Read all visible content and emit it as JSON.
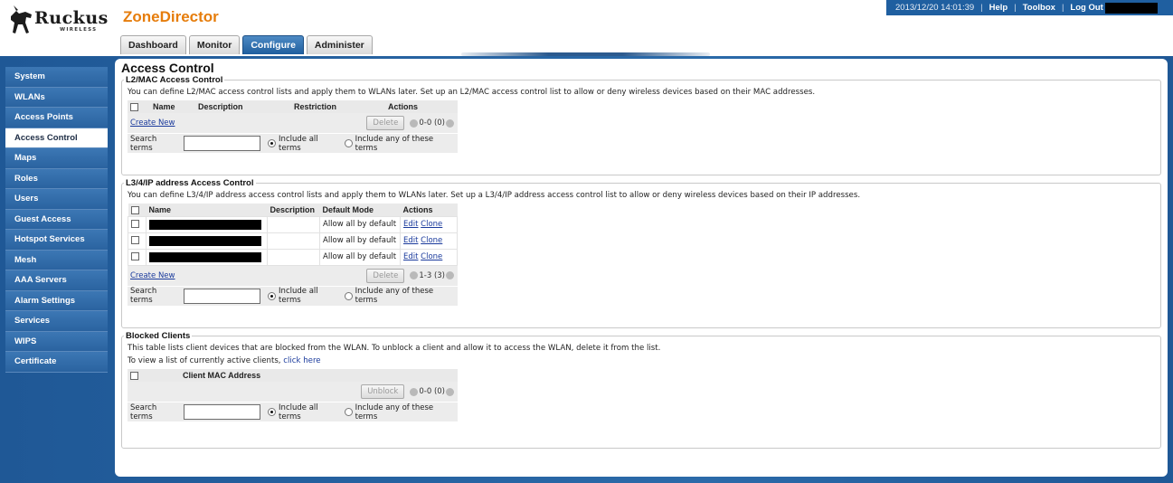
{
  "header": {
    "brand_word": "Ruckus",
    "brand_sub": "WIRELESS",
    "product": "ZoneDirector",
    "timestamp": "2013/12/20 14:01:39",
    "links": [
      "Help",
      "Toolbox",
      "Log Out"
    ]
  },
  "tabs": [
    {
      "label": "Dashboard",
      "active": false
    },
    {
      "label": "Monitor",
      "active": false
    },
    {
      "label": "Configure",
      "active": true
    },
    {
      "label": "Administer",
      "active": false
    }
  ],
  "sidebar": {
    "items": [
      {
        "label": "System"
      },
      {
        "label": "WLANs"
      },
      {
        "label": "Access Points"
      },
      {
        "label": "Access Control",
        "active": true
      },
      {
        "label": "Maps"
      },
      {
        "label": "Roles"
      },
      {
        "label": "Users"
      },
      {
        "label": "Guest Access"
      },
      {
        "label": "Hotspot Services"
      },
      {
        "label": "Mesh"
      },
      {
        "label": "AAA Servers"
      },
      {
        "label": "Alarm Settings"
      },
      {
        "label": "Services"
      },
      {
        "label": "WIPS"
      },
      {
        "label": "Certificate"
      }
    ]
  },
  "page": {
    "title": "Access Control"
  },
  "l2": {
    "legend": "L2/MAC Access Control",
    "description": "You can define L2/MAC access control lists and apply them to WLANs later. Set up an L2/MAC access control list to allow or deny wireless devices based on their MAC addresses.",
    "columns": [
      "Name",
      "Description",
      "Restriction",
      "Actions"
    ],
    "create_new": "Create New",
    "delete_label": "Delete",
    "pager": "0-0 (0)",
    "search_label": "Search terms",
    "search_value": "",
    "radio_all": "Include all terms",
    "radio_any": "Include any of these terms"
  },
  "l3": {
    "legend": "L3/4/IP address Access Control",
    "description": "You can define L3/4/IP address access control lists and apply them to WLANs later. Set up a L3/4/IP address access control list to allow or deny wireless devices based on their IP addresses.",
    "columns": [
      "Name",
      "Description",
      "Default Mode",
      "Actions"
    ],
    "rows": [
      {
        "description": "",
        "default_mode": "Allow all by default",
        "edit": "Edit",
        "clone": "Clone"
      },
      {
        "description": "",
        "default_mode": "Allow all by default",
        "edit": "Edit",
        "clone": "Clone"
      },
      {
        "description": "",
        "default_mode": "Allow all by default",
        "edit": "Edit",
        "clone": "Clone"
      }
    ],
    "create_new": "Create New",
    "delete_label": "Delete",
    "pager": "1-3 (3)",
    "search_label": "Search terms",
    "search_value": "",
    "radio_all": "Include all terms",
    "radio_any": "Include any of these terms"
  },
  "blocked": {
    "legend": "Blocked Clients",
    "description": "This table lists client devices that are blocked from the WLAN. To unblock a client and allow it to access the WLAN, delete it from the list.",
    "view_text": "To view a list of currently active clients, ",
    "view_link": "click here",
    "columns": [
      "Client MAC Address"
    ],
    "unblock_label": "Unblock",
    "pager": "0-0 (0)",
    "search_label": "Search terms",
    "search_value": "",
    "radio_all": "Include all terms",
    "radio_any": "Include any of these terms"
  },
  "colors": {
    "accent": "#e67d0c",
    "frame_blue": "#2b6aa9",
    "tab_active": "#1f5e9e"
  }
}
